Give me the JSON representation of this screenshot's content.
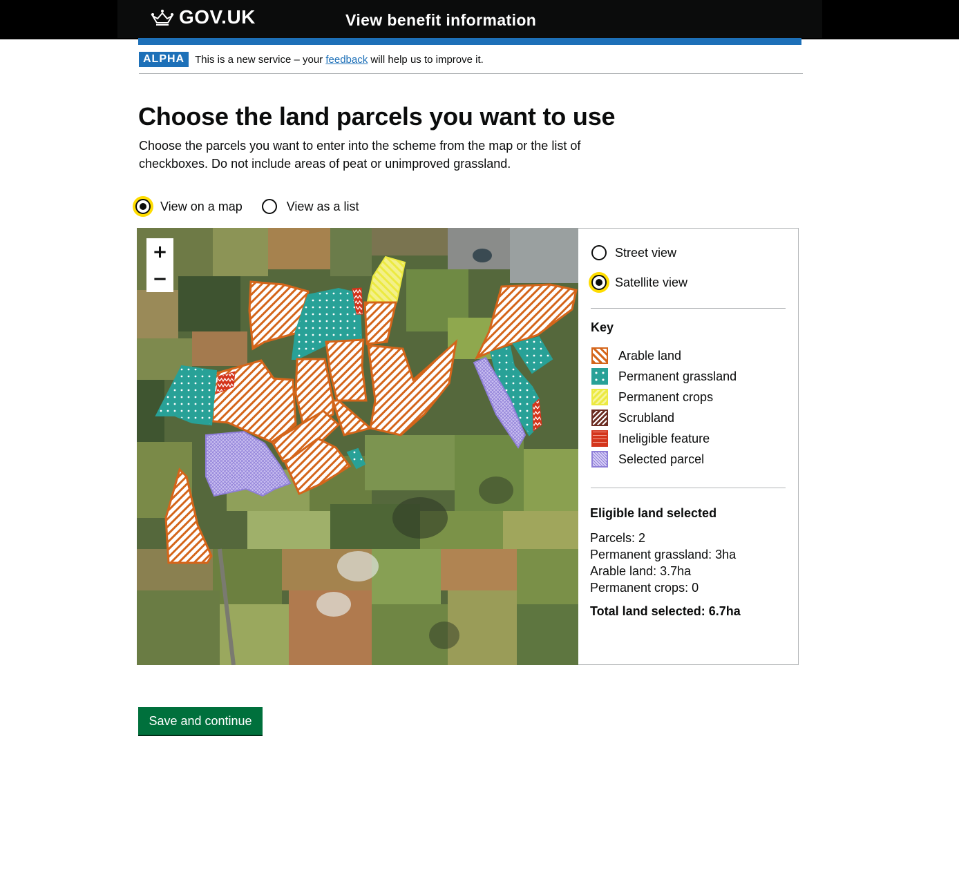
{
  "header": {
    "logo_text": "GOV.UK",
    "service_name": "View benefit information",
    "logo_icon": "crown-icon"
  },
  "phase_banner": {
    "tag": "ALPHA",
    "text_before": "This is a new service – your ",
    "link_text": "feedback",
    "text_after": " will help us to improve it."
  },
  "page": {
    "title": "Choose the land parcels you want to use",
    "lede": "Choose the parcels you want to enter into the scheme from the map or the list of checkboxes. Do not include areas of peat or unimproved grassland."
  },
  "view_options": [
    {
      "label": "View on a map",
      "checked": true
    },
    {
      "label": "View as a list",
      "checked": false
    }
  ],
  "map": {
    "zoom_in": "+",
    "zoom_out": "−"
  },
  "layer_options": [
    {
      "label": "Street view",
      "checked": false
    },
    {
      "label": "Satellite view",
      "checked": true
    }
  ],
  "key": {
    "title": "Key",
    "items": [
      {
        "label": "Arable land",
        "color": "#d4651a",
        "pattern": "diagonal-hatch"
      },
      {
        "label": "Permanent grassland",
        "color": "#28a197",
        "pattern": "dots"
      },
      {
        "label": "Permanent crops",
        "color": "#ecea41",
        "pattern": "diagonal-hatch"
      },
      {
        "label": "Scrubland",
        "color": "#6b2d22",
        "pattern": "diagonal-hatch"
      },
      {
        "label": "Ineligible feature",
        "color": "#d4351c",
        "pattern": "zigzag"
      },
      {
        "label": "Selected parcel",
        "color": "#8f7fd8",
        "pattern": "crosshatch"
      }
    ]
  },
  "stats": {
    "title": "Eligible land selected",
    "parcels": "Parcels: 2",
    "grassland": "Permanent grassland: 3ha",
    "arable": "Arable land: 3.7ha",
    "crops": "Permanent crops: 0",
    "total": "Total land selected: 6.7ha"
  },
  "actions": {
    "save_label": "Save and continue"
  },
  "colors": {
    "header": "#0b0c0c",
    "brand_blue": "#1d70b8",
    "button_green": "#00703c",
    "focus_yellow": "#ffdd00"
  }
}
